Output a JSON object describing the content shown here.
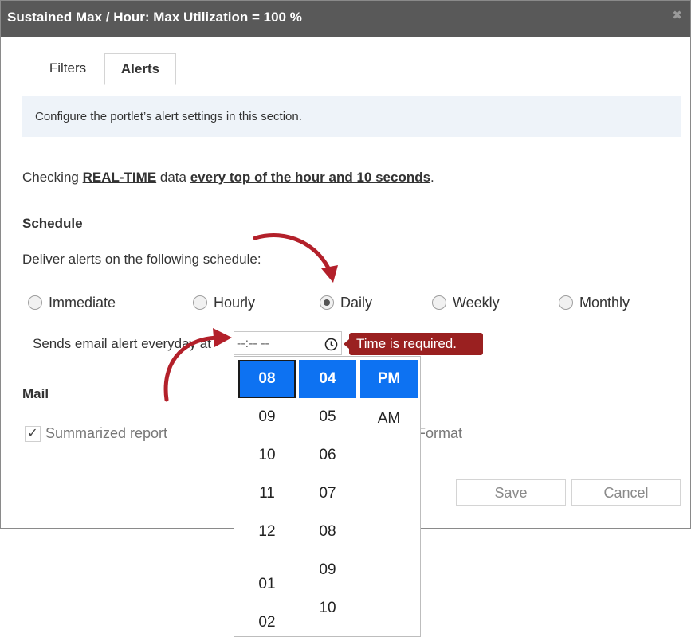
{
  "dialog": {
    "title": "Sustained Max / Hour: Max Utilization = 100 %",
    "close_icon": "close-icon"
  },
  "tabs": [
    {
      "label": "Filters",
      "active": false
    },
    {
      "label": "Alerts",
      "active": true
    }
  ],
  "info": "Configure the portlet’s alert settings in this section.",
  "checking": {
    "prefix": "Checking ",
    "data_type": "REAL-TIME",
    "middle": " data ",
    "frequency": "every top of the hour and 10 seconds",
    "suffix": "."
  },
  "schedule": {
    "heading": "Schedule",
    "deliver_label": "Deliver alerts on the following schedule:",
    "options": [
      "Immediate",
      "Hourly",
      "Daily",
      "Weekly",
      "Monthly"
    ],
    "selected": "Daily",
    "sends_label": "Sends email alert everyday at",
    "time_value": "--:-- --",
    "time_error": "Time is required."
  },
  "mail": {
    "heading": "Mail",
    "summarized_label": "Summarized report",
    "summarized_checked": true,
    "format_label": "Format"
  },
  "buttons": {
    "save": "Save",
    "cancel": "Cancel"
  },
  "time_picker": {
    "hours": [
      "08",
      "09",
      "10",
      "11",
      "12",
      "01",
      "02"
    ],
    "minutes": [
      "04",
      "05",
      "06",
      "07",
      "08",
      "09",
      "10"
    ],
    "periods": [
      "PM",
      "AM"
    ],
    "selected_hour": "08",
    "selected_minute": "04",
    "selected_period": "PM"
  },
  "colors": {
    "titlebar": "#595959",
    "accent": "#0d72f2",
    "error": "#9a2020",
    "annotation_arrow": "#b3202a",
    "info_bg": "#eef3f9"
  }
}
